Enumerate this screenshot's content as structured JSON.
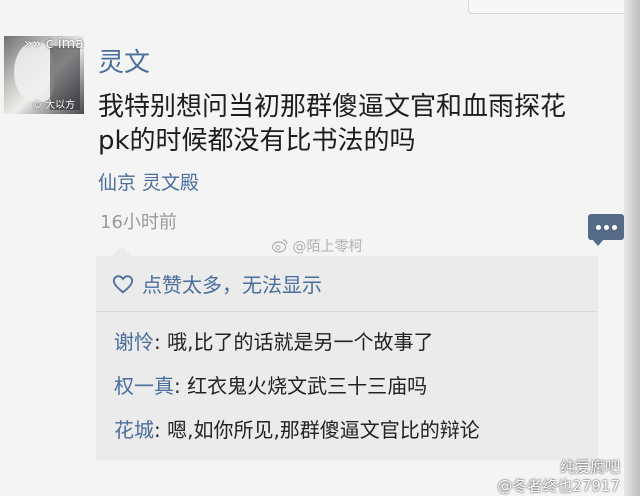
{
  "post": {
    "username": "灵文",
    "text_line1": "我特别想问当初那群傻逼文官和血雨探花",
    "text_line2": "pk的时候都没有比书法的吗",
    "location": "仙京 灵文殿",
    "timestamp": "16小时前"
  },
  "avatar_watermark": {
    "line1": "»» c image",
    "line2": "© 大以方"
  },
  "watermark": "@陌上零柯",
  "likes": {
    "text": "点赞太多，无法显示"
  },
  "comments": [
    {
      "name": "谢怜",
      "text": ": 哦,比了的话就是另一个故事了"
    },
    {
      "name": "权一真",
      "text": ": 红衣鬼火烧文武三十三庙吗"
    },
    {
      "name": "花城",
      "text": ": 嗯,如你所见,那群傻逼文官比的辩论"
    }
  ],
  "footer_watermarks": {
    "line1": "纯爱腐吧",
    "line2": "@冬者终也27917"
  },
  "colors": {
    "link": "#4a6e9c",
    "comment_button": "#556a86",
    "panel_bg": "#ebebeb",
    "page_bg": "#f4f4f4"
  },
  "icons": [
    "heart-icon",
    "comment-icon"
  ]
}
